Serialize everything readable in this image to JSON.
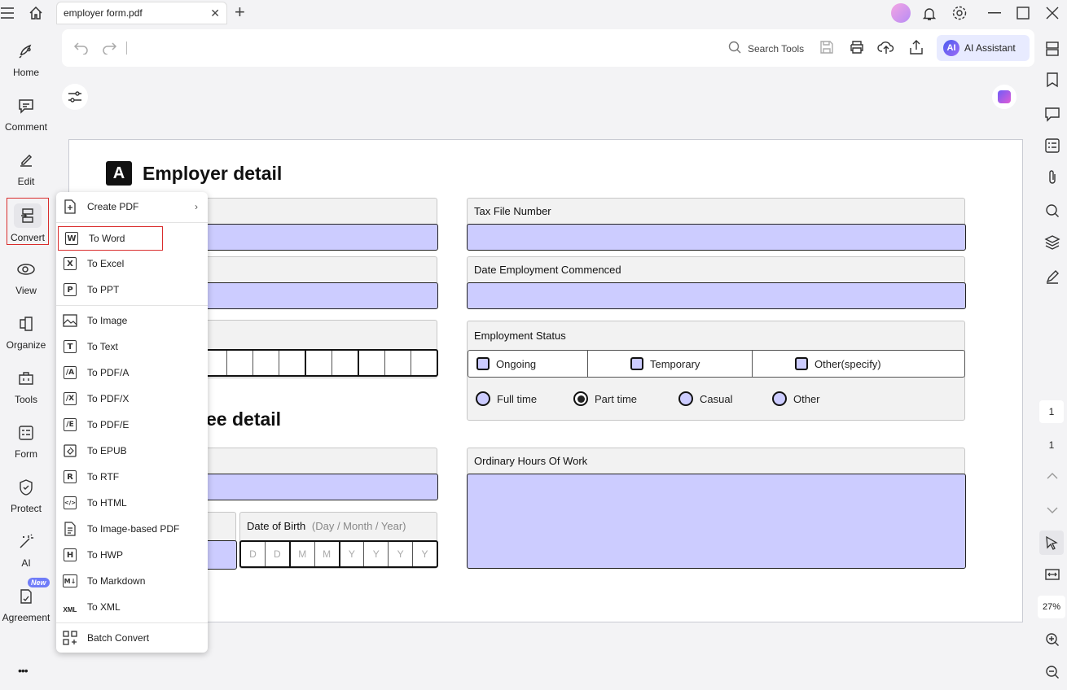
{
  "tab": {
    "title": "employer form.pdf"
  },
  "sidebar": {
    "items": [
      {
        "label": "Home"
      },
      {
        "label": "Comment"
      },
      {
        "label": "Edit"
      },
      {
        "label": "Convert"
      },
      {
        "label": "View"
      },
      {
        "label": "Organize"
      },
      {
        "label": "Tools"
      },
      {
        "label": "Form"
      },
      {
        "label": "Protect"
      },
      {
        "label": "AI"
      },
      {
        "label": "Agreement",
        "badge": "New"
      }
    ],
    "more": "•••"
  },
  "toolbar": {
    "search_label": "Search Tools",
    "ai_label": "AI Assistant",
    "ai_logo": "AI"
  },
  "menu": {
    "items": [
      {
        "label": "Create PDF",
        "icon": "C"
      },
      {
        "label": "To Word",
        "icon": "W"
      },
      {
        "label": "To Excel",
        "icon": "X"
      },
      {
        "label": "To PPT",
        "icon": "P"
      },
      {
        "label": "To Image",
        "icon": "image"
      },
      {
        "label": "To Text",
        "icon": "T"
      },
      {
        "label": "To PDF/A",
        "icon": "/A"
      },
      {
        "label": "To PDF/X",
        "icon": "/X"
      },
      {
        "label": "To PDF/E",
        "icon": "/E"
      },
      {
        "label": "To EPUB",
        "icon": "epub"
      },
      {
        "label": "To RTF",
        "icon": "R"
      },
      {
        "label": "To HTML",
        "icon": "</>"
      },
      {
        "label": "To Image-based PDF",
        "icon": "doc"
      },
      {
        "label": "To HWP",
        "icon": "H"
      },
      {
        "label": "To Markdown",
        "icon": "M↓"
      },
      {
        "label": "To XML",
        "icon": "XML"
      },
      {
        "label": "Batch Convert",
        "icon": "grid"
      }
    ]
  },
  "document": {
    "section_a": {
      "letter": "A",
      "title": "Employer detail"
    },
    "section_b": {
      "title_visible": "ee detail"
    },
    "tax_file_number": "Tax File Number",
    "date_employment": "Date Employment Commenced",
    "employment_status": {
      "label": "Employment Status",
      "options": [
        "Ongoing",
        "Temporary",
        "Other(specify)"
      ],
      "types": [
        "Full time",
        "Part time",
        "Casual",
        "Other"
      ],
      "selected_type": "Part time"
    },
    "ordinary_hours": "Ordinary Hours Of Work",
    "dob": {
      "label": "Date of Birth",
      "hint": "(Day / Month / Year)",
      "cells": [
        "D",
        "D",
        "M",
        "M",
        "Y",
        "Y",
        "Y",
        "Y"
      ]
    }
  },
  "rightbar": {
    "page_current": "1",
    "page_total": "1",
    "zoom": "27%"
  }
}
